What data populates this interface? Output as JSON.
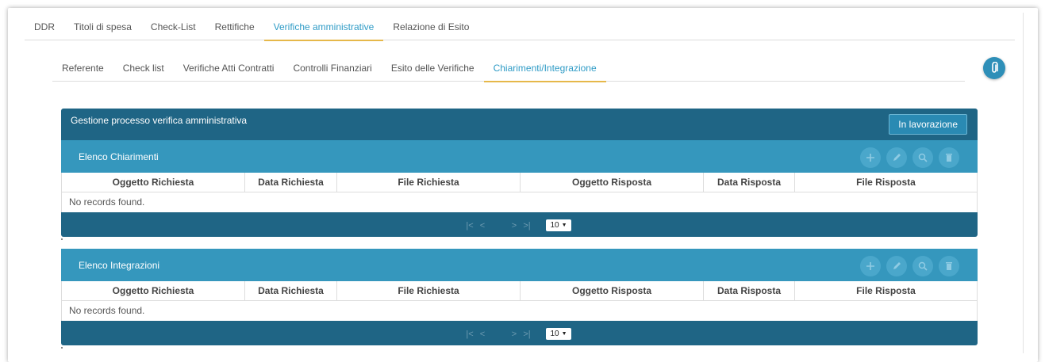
{
  "top_tabs": [
    {
      "label": "DDR"
    },
    {
      "label": "Titoli di spesa"
    },
    {
      "label": "Check-List"
    },
    {
      "label": "Rettifiche"
    },
    {
      "label": "Verifiche amministrative",
      "active": true
    },
    {
      "label": "Relazione di Esito"
    }
  ],
  "sub_tabs": [
    {
      "label": "Referente"
    },
    {
      "label": "Check list"
    },
    {
      "label": "Verifiche Atti Contratti"
    },
    {
      "label": "Controlli Finanziari"
    },
    {
      "label": "Esito delle Verifiche"
    },
    {
      "label": "Chiarimenti/Integrazione",
      "active": true
    }
  ],
  "attach_icon": "paperclip-icon",
  "panel": {
    "title": "Gestione processo verifica amministrativa",
    "status_button": "In lavorazione"
  },
  "columns": [
    "Oggetto Richiesta",
    "Data Richiesta",
    "File Richiesta",
    "Oggetto Risposta",
    "Data Risposta",
    "File Risposta"
  ],
  "grids": [
    {
      "title": "Elenco Chiarimenti",
      "empty_text": "No records found.",
      "page_size": "10"
    },
    {
      "title": "Elenco Integrazioni",
      "empty_text": "No records found.",
      "page_size": "10"
    }
  ],
  "grid_tools": [
    "plus-icon",
    "pencil-icon",
    "search-icon",
    "trash-icon"
  ],
  "pager_icons": [
    "first-page-icon",
    "prev-page-icon",
    "next-page-icon",
    "last-page-icon"
  ],
  "colors": {
    "header_dark": "#1f6585",
    "header_light": "#3597bd",
    "accent": "#e6b84a",
    "link": "#2e9bc6"
  }
}
